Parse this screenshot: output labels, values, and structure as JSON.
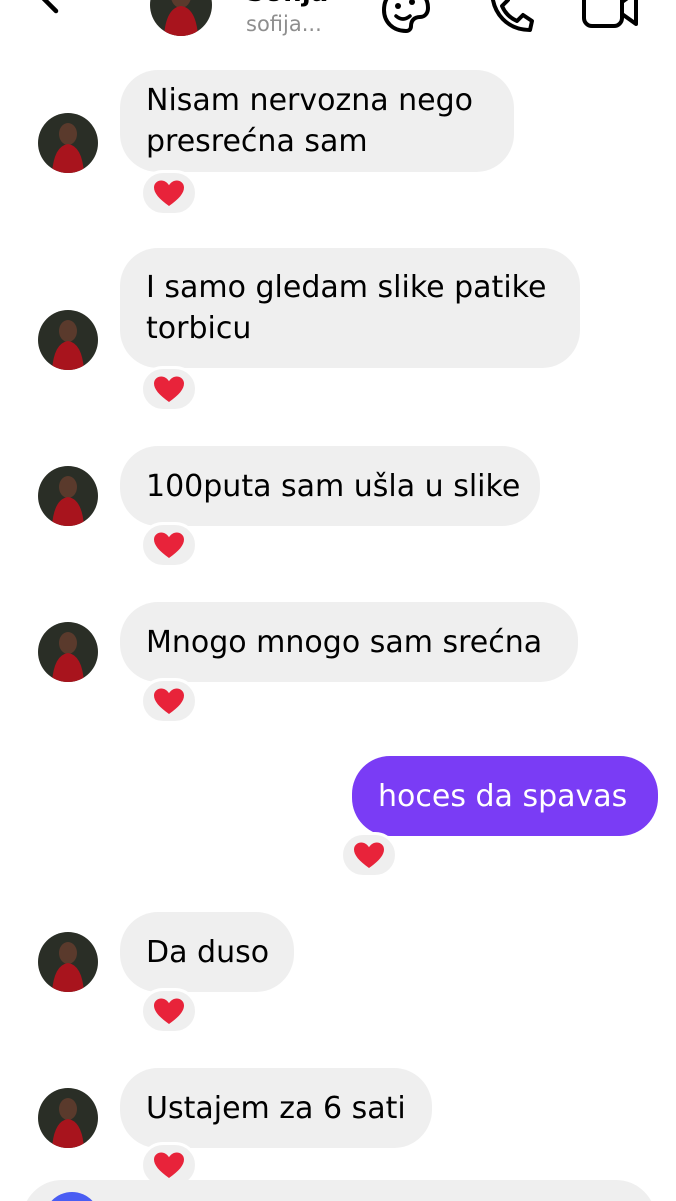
{
  "header": {
    "name": "Sofija",
    "handle": "sofija..."
  },
  "colors": {
    "outgoing_bubble": "#7a3cf5",
    "incoming_bubble": "#efefef",
    "reaction_heart": "#e8233a",
    "camera_button": "#4a5df3"
  },
  "messages": [
    {
      "direction": "incoming",
      "lines": [
        "Nisam nervozna nego",
        "presrećna sam"
      ],
      "reaction": "heart"
    },
    {
      "direction": "incoming",
      "lines": [
        "I samo gledam slike patike",
        "torbicu"
      ],
      "reaction": "heart"
    },
    {
      "direction": "incoming",
      "lines": [
        "100puta sam ušla u slike"
      ],
      "reaction": "heart"
    },
    {
      "direction": "incoming",
      "lines": [
        "Mnogo mnogo sam srećna"
      ],
      "reaction": "heart"
    },
    {
      "direction": "outgoing",
      "lines": [
        "hoces da spavas"
      ],
      "reaction": "heart"
    },
    {
      "direction": "incoming",
      "lines": [
        "Da duso"
      ],
      "reaction": "heart"
    },
    {
      "direction": "incoming",
      "lines": [
        "Ustajem za 6 sati"
      ],
      "reaction": "heart"
    }
  ]
}
